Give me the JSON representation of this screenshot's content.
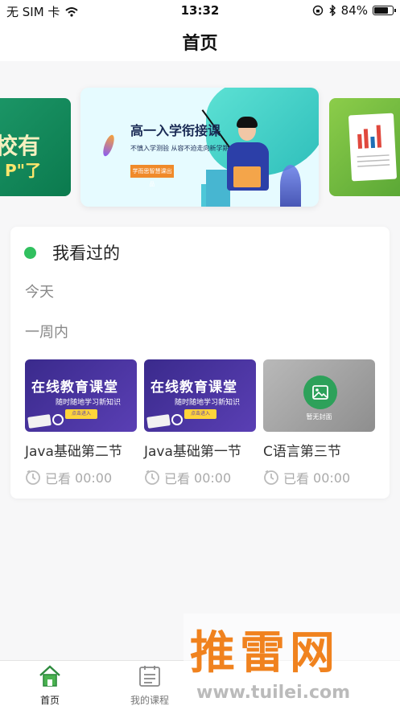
{
  "status_bar": {
    "carrier": "无 SIM 卡",
    "time": "13:32",
    "battery_text": "84%",
    "battery_level": 0.84
  },
  "nav": {
    "title": "首页"
  },
  "banners": {
    "left": {
      "text_main": "校有",
      "text_sub": "P\"了"
    },
    "center": {
      "headline": "高一入学衔接课",
      "subline": "不慎入学测验 从容不迫走向新学期",
      "tag": "学而思智慧课出品"
    }
  },
  "history": {
    "heading": "我看过的",
    "today_label": "今天",
    "week_label": "一周内",
    "courses": [
      {
        "name": "Java基础第二节",
        "watched_label": "已看",
        "watched_time": "00:00",
        "thumb": {
          "title": "在线教育课堂",
          "subtitle": "随时随地学习新知识",
          "button": "点击进入"
        }
      },
      {
        "name": "Java基础第一节",
        "watched_label": "已看",
        "watched_time": "00:00",
        "thumb": {
          "title": "在线教育课堂",
          "subtitle": "随时随地学习新知识",
          "button": "点击进入"
        }
      },
      {
        "name": "C语言第三节",
        "watched_label": "已看",
        "watched_time": "00:00",
        "thumb": {
          "no_cover": "暂无封面"
        }
      }
    ]
  },
  "tabs": [
    {
      "label": "首页",
      "icon": "home-icon",
      "active": true
    },
    {
      "label": "我的课程",
      "icon": "course-list-icon",
      "active": false
    }
  ],
  "watermark": {
    "brand": "推雷网",
    "url": "www.tuilei.com"
  },
  "colors": {
    "accent_green": "#31c05f",
    "watermark_orange": "#f0821e",
    "thumb_purple": "#3a2a8c"
  }
}
